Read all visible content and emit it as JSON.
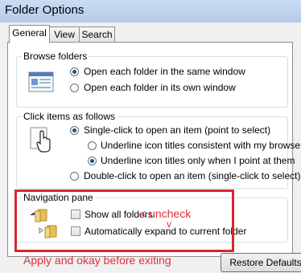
{
  "window": {
    "title": "Folder Options"
  },
  "tabs": [
    {
      "label": "General",
      "active": true
    },
    {
      "label": "View",
      "active": false
    },
    {
      "label": "Search",
      "active": false
    }
  ],
  "browse_folders": {
    "title": "Browse folders",
    "options": [
      {
        "label": "Open each folder in the same window",
        "selected": true
      },
      {
        "label": "Open each folder in its own window",
        "selected": false
      }
    ]
  },
  "click_items": {
    "title": "Click items as follows",
    "single_click": {
      "label": "Single-click to open an item (point to select)",
      "selected": true
    },
    "sub_options": [
      {
        "label": "Underline icon titles consistent with my browser",
        "selected": false
      },
      {
        "label": "Underline icon titles only when I point at them",
        "selected": true
      }
    ],
    "double_click": {
      "label": "Double-click to open an item (single-click to select)",
      "selected": false
    }
  },
  "navigation_pane": {
    "title": "Navigation pane",
    "options": [
      {
        "label": "Show all folders",
        "checked": false
      },
      {
        "label": "Automatically expand to current folder",
        "checked": false
      }
    ]
  },
  "annotations": {
    "uncheck": "< uncheck",
    "arrow": "v",
    "apply_note": "Apply and okay before exiting",
    "color": "#e0303a"
  },
  "buttons": {
    "restore_defaults": "Restore Defaults"
  }
}
